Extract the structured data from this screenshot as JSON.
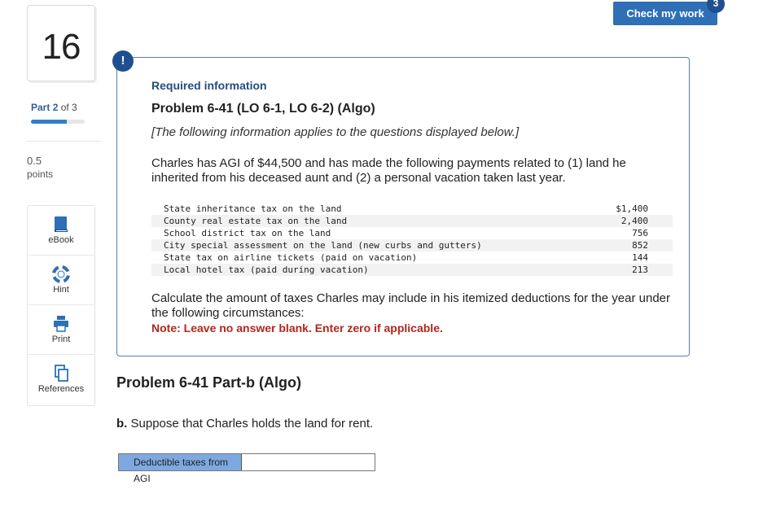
{
  "question": {
    "number": "16"
  },
  "part": {
    "label": "Part",
    "current": "2",
    "of_text": "of 3",
    "progress": 0.67
  },
  "points": {
    "value": "0.5",
    "unit": "points"
  },
  "tools": [
    {
      "label": "eBook",
      "icon": "book-icon"
    },
    {
      "label": "Hint",
      "icon": "lifebuoy-icon"
    },
    {
      "label": "Print",
      "icon": "printer-icon"
    },
    {
      "label": "References",
      "icon": "documents-icon"
    }
  ],
  "header": {
    "check_label": "Check my work",
    "check_badge": "3"
  },
  "info": {
    "alert": "!",
    "heading": "Required information",
    "title": "Problem 6-41 (LO 6-1, LO 6-2) (Algo)",
    "applies": "[The following information applies to the questions displayed below.]",
    "description": "Charles has AGI of $44,500 and has made the following payments related to (1) land he inherited from his deceased aunt and (2) a personal vacation taken last year.",
    "rows": [
      {
        "item": "State inheritance tax on the land",
        "amount": "$1,400"
      },
      {
        "item": "County real estate tax on the land",
        "amount": "2,400"
      },
      {
        "item": "School district tax on the land",
        "amount": "756"
      },
      {
        "item": "City special assessment on the land (new curbs and gutters)",
        "amount": "852"
      },
      {
        "item": "State tax on airline tickets (paid on vacation)",
        "amount": "144"
      },
      {
        "item": "Local hotel tax (paid during vacation)",
        "amount": "213"
      }
    ],
    "calculate": "Calculate the amount of taxes Charles may include in his itemized deductions for the year under the following circumstances:",
    "note": "Note: Leave no answer blank. Enter zero if applicable."
  },
  "part_b": {
    "title": "Problem 6-41 Part-b (Algo)",
    "prefix": "b.",
    "question": "Suppose that Charles holds the land for rent.",
    "answer_label": "Deductible taxes from AGI",
    "answer_value": ""
  },
  "colors": {
    "accent": "#2f6fb5",
    "badge": "#1f4f8f",
    "note": "#b3261e",
    "label_bg": "#7da9e0"
  }
}
